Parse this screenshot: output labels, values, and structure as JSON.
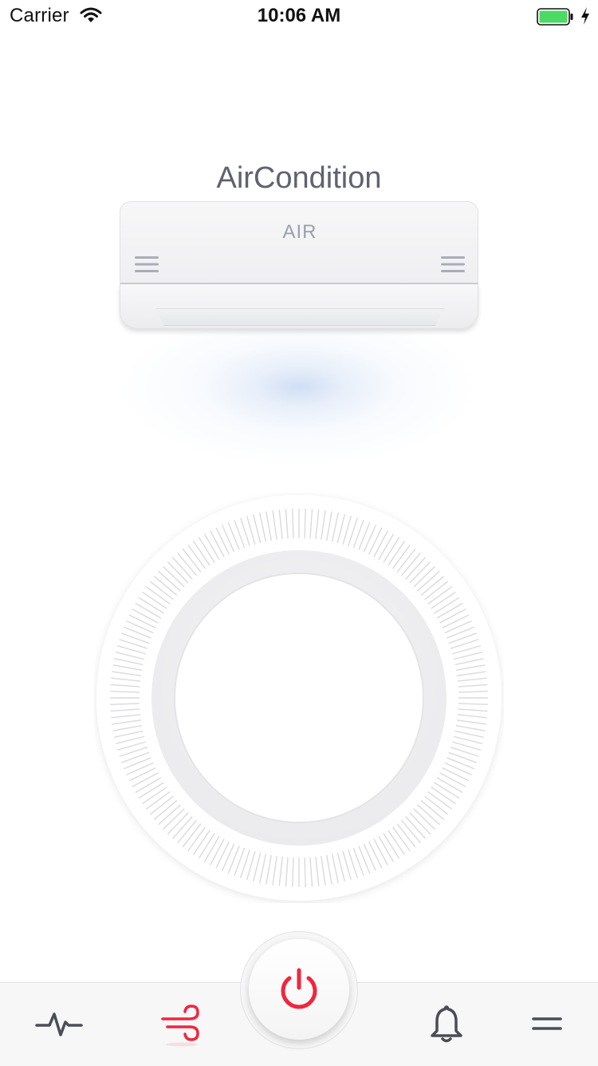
{
  "status_bar": {
    "carrier": "Carrier",
    "time": "10:06 AM",
    "battery_color": "#4cd964"
  },
  "header": {
    "title": "AirCondition"
  },
  "ac_unit": {
    "brand": "AIR"
  },
  "colors": {
    "accent": "#f0263e",
    "icon": "#4a4d57",
    "title": "#5f6270"
  },
  "tab_bar": {
    "items": [
      {
        "icon": "activity-icon"
      },
      {
        "icon": "wind-icon",
        "active": true
      },
      {
        "icon": "power-icon"
      },
      {
        "icon": "bell-icon"
      },
      {
        "icon": "menu-icon"
      }
    ]
  }
}
